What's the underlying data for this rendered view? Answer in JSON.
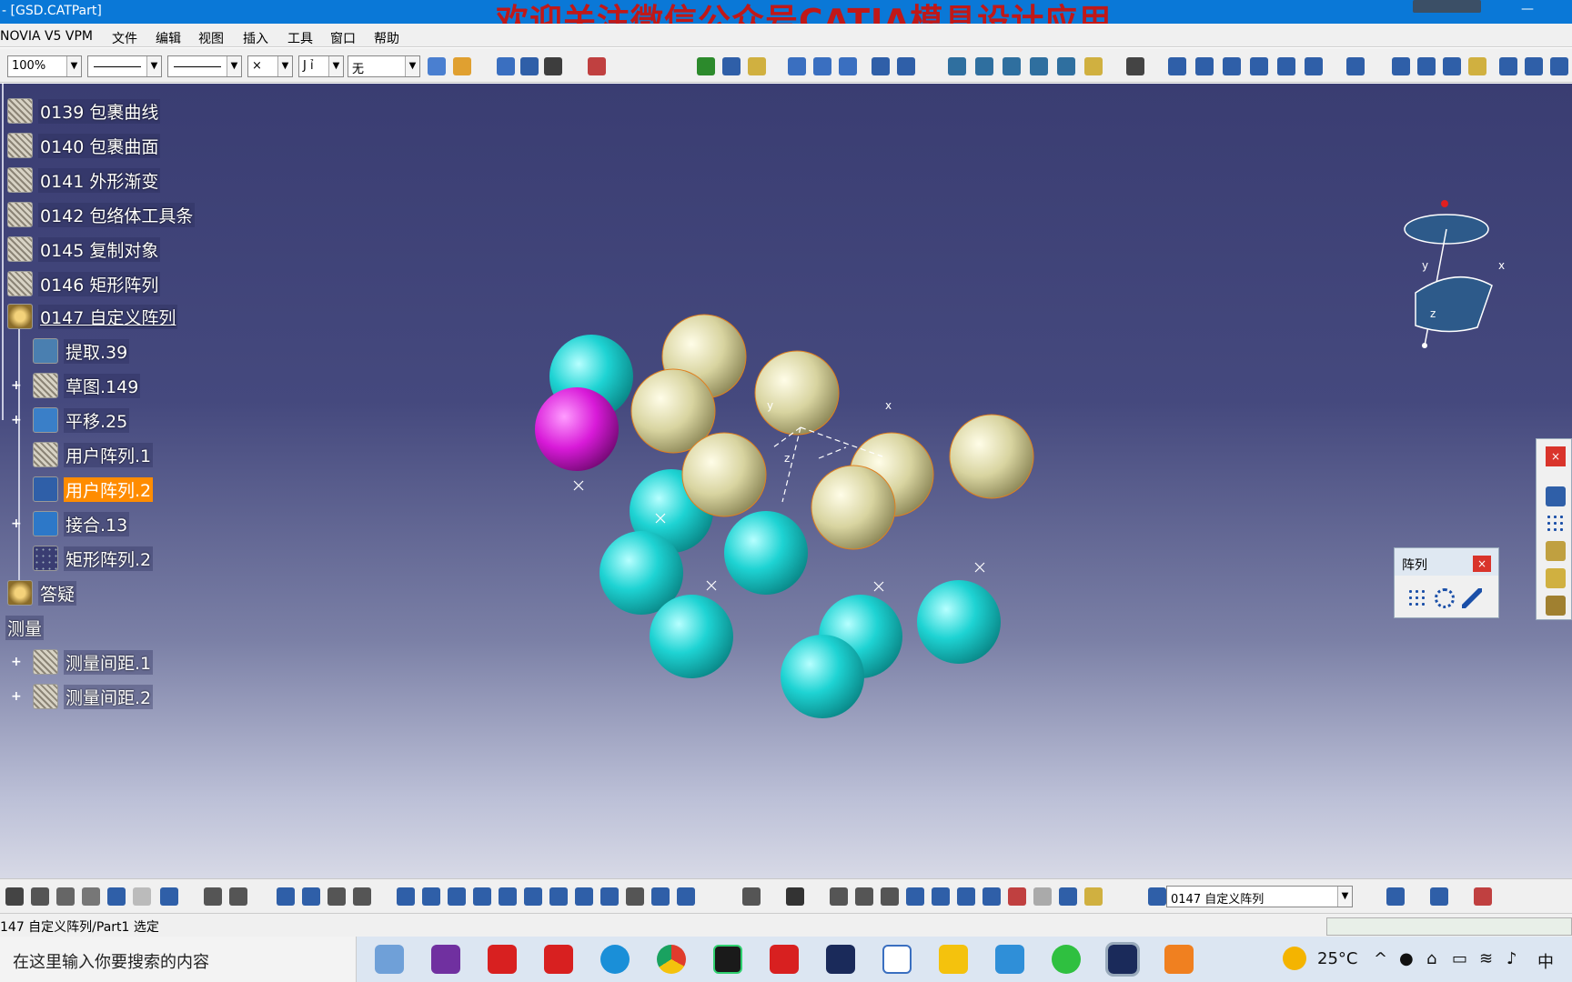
{
  "window": {
    "title": "- [GSD.CATPart]",
    "overlay_banner": "欢迎关注微信公众号CATIA模具设计应用"
  },
  "menu": [
    "NOVIA V5 VPM",
    "文件",
    "编辑",
    "视图",
    "插入",
    "工具",
    "窗口",
    "帮助"
  ],
  "toolbar_top": {
    "zoom_value": "100%",
    "line_type": "",
    "line_weight": "",
    "point_style": "×",
    "layer_partial": "J ỉ",
    "render_value": "无"
  },
  "tree": {
    "items": [
      {
        "label": "0139 包裹曲线",
        "level": 0
      },
      {
        "label": "0140 包裹曲面",
        "level": 0
      },
      {
        "label": "0141 外形渐变",
        "level": 0
      },
      {
        "label": "0142 包络体工具条",
        "level": 0
      },
      {
        "label": "0145 复制对象",
        "level": 0
      },
      {
        "label": "0146 矩形阵列",
        "level": 0
      },
      {
        "label": "0147 自定义阵列",
        "level": 0,
        "underline": true
      },
      {
        "label": "提取.39",
        "level": 1
      },
      {
        "label": "草图.149",
        "level": 1,
        "expand": true
      },
      {
        "label": "平移.25",
        "level": 1,
        "expand": true
      },
      {
        "label": "用户阵列.1",
        "level": 1
      },
      {
        "label": "用户阵列.2",
        "level": 1,
        "selected": true
      },
      {
        "label": "接合.13",
        "level": 1,
        "expand": true
      },
      {
        "label": "矩形阵列.2",
        "level": 1
      },
      {
        "label": "答疑",
        "level": 0
      },
      {
        "label": "测量",
        "level": -1
      },
      {
        "label": "测量间距.1",
        "level": 1,
        "expand": true
      },
      {
        "label": "测量间距.2",
        "level": 1,
        "expand": true
      }
    ]
  },
  "compass": {
    "x_label": "x",
    "y_label": "y",
    "z_label": "z"
  },
  "axis_labels": {
    "x": "x",
    "y": "y",
    "z": "z"
  },
  "array_panel": {
    "title": "阵列",
    "close": "×"
  },
  "right_bar": {
    "close": "×"
  },
  "toolbar_bottom": {
    "workbench_value": "0147 自定义阵列"
  },
  "status": {
    "text": "147 自定义阵列/Part1 选定"
  },
  "taskbar": {
    "search_placeholder": "在这里输入你要搜索的内容",
    "weather": "25°C",
    "ime": "中"
  },
  "colors": {
    "accent": "#0a78d7",
    "highlight": "#ff8c00",
    "cyan_sphere": "#1ed3d3",
    "beige_sphere": "#d8d4a0",
    "magenta_sphere": "#d81ad8",
    "banner": "#c01818"
  }
}
